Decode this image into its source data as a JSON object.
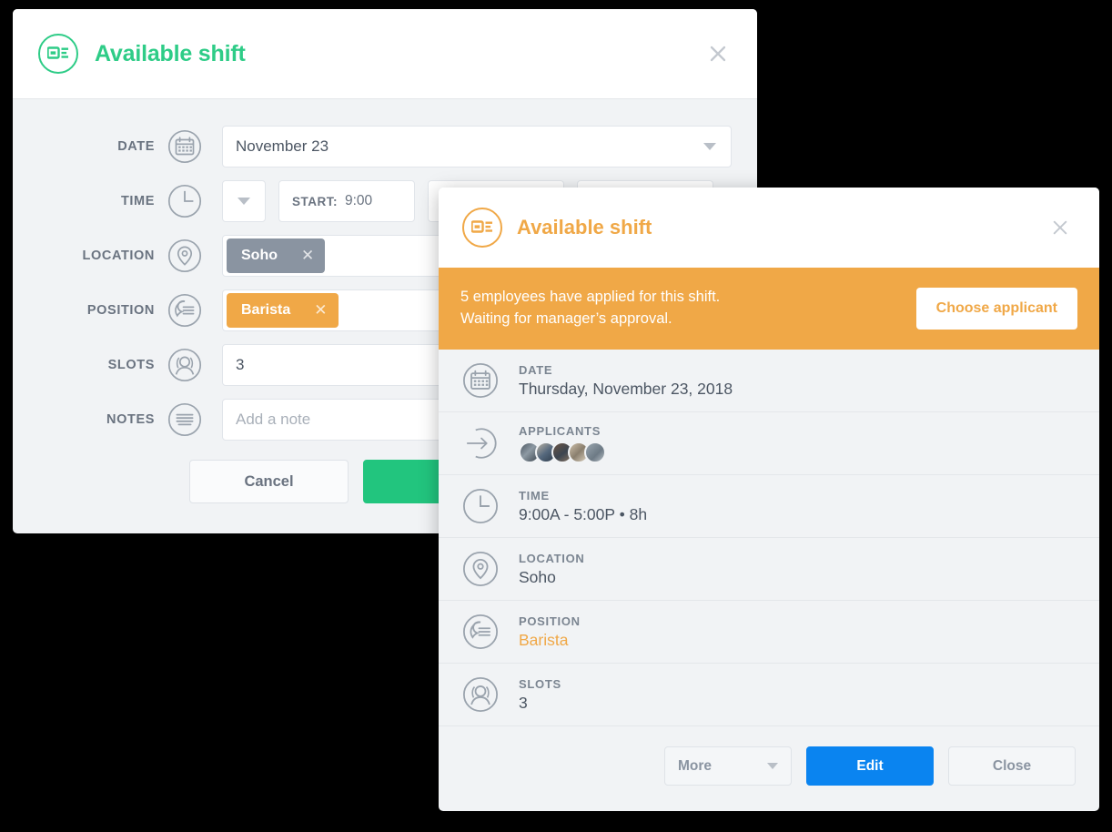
{
  "edit_dialog": {
    "title": "Available shift",
    "logo_icon": "available-shift-logo-icon",
    "close_icon": "close-icon",
    "rows": {
      "date": {
        "label": "DATE",
        "icon": "calendar-icon",
        "value": "November 23",
        "dropdown_icon": "chevron-down-icon"
      },
      "time": {
        "label": "TIME",
        "icon": "clock-icon",
        "dropdown_icon": "chevron-down-icon",
        "start_label": "START:",
        "start_value": "9:00"
      },
      "location": {
        "label": "LOCATION",
        "icon": "location-pin-icon",
        "chip": "Soho",
        "chip_remove_icon": "close-icon"
      },
      "position": {
        "label": "POSITION",
        "icon": "position-badge-icon",
        "chip": "Barista",
        "chip_remove_icon": "close-icon"
      },
      "slots": {
        "label": "SLOTS",
        "icon": "person-icon",
        "value": "3"
      },
      "notes": {
        "label": "NOTES",
        "icon": "notes-lines-icon",
        "placeholder": "Add a note"
      }
    },
    "cancel_label": "Cancel",
    "save_label": ""
  },
  "view_dialog": {
    "title": "Available shift",
    "logo_icon": "available-shift-logo-icon",
    "close_icon": "close-icon",
    "banner": {
      "line1": "5 employees have applied for this shift.",
      "line2": "Waiting for manager’s approval.",
      "button_label": "Choose applicant",
      "background_color": "#f0a847"
    },
    "details": [
      {
        "label": "DATE",
        "icon": "calendar-icon",
        "value": "Thursday, November 23, 2018"
      },
      {
        "label": "APPLICANTS",
        "icon": "sign-in-arrow-icon",
        "value": "",
        "avatar_count": 5
      },
      {
        "label": "TIME",
        "icon": "clock-icon",
        "value": "9:00A - 5:00P • 8h"
      },
      {
        "label": "LOCATION",
        "icon": "location-pin-icon",
        "value": "Soho"
      },
      {
        "label": "POSITION",
        "icon": "position-badge-icon",
        "value": "Barista",
        "accent": true
      },
      {
        "label": "SLOTS",
        "icon": "person-icon",
        "value": "3"
      }
    ],
    "footer": {
      "more_label": "More",
      "more_dropdown_icon": "chevron-down-icon",
      "edit_label": "Edit",
      "close_label": "Close"
    }
  },
  "colors": {
    "green_accent": "#2ecc87",
    "green_button": "#22c57e",
    "orange_accent": "#f0a847",
    "blue_button": "#0a84f0",
    "gray_chip": "#8a94a1",
    "panel_bg": "#f1f3f5"
  }
}
